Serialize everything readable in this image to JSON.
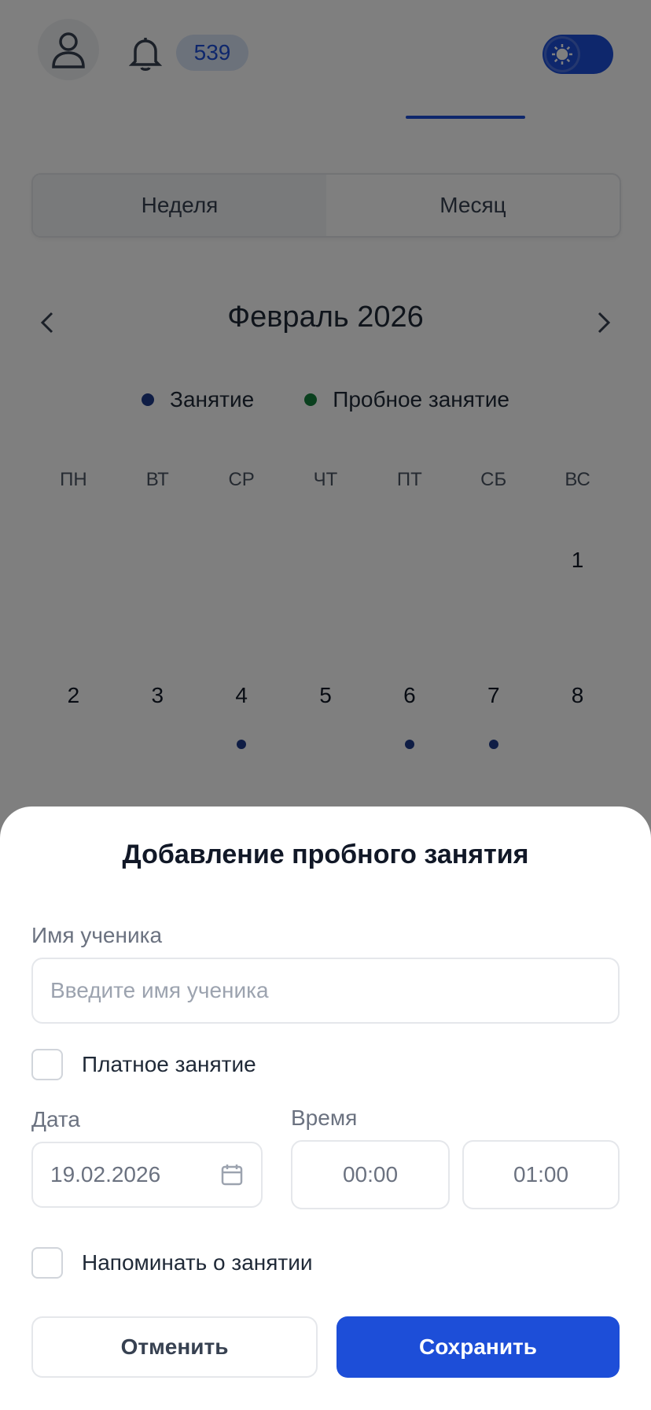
{
  "header": {
    "notifications_count": "539"
  },
  "view_switch": {
    "week_label": "Неделя",
    "month_label": "Месяц",
    "selected": "week"
  },
  "calendar": {
    "month_title": "Февраль 2026",
    "legend": [
      {
        "label": "Занятие",
        "color": "#1e3a8a"
      },
      {
        "label": "Пробное занятие",
        "color": "#15803d"
      }
    ],
    "weekdays": [
      "ПН",
      "ВТ",
      "СР",
      "ЧТ",
      "ПТ",
      "СБ",
      "ВС"
    ],
    "week1": [
      "",
      "",
      "",
      "",
      "",
      "",
      "1"
    ],
    "week2": [
      "2",
      "3",
      "4",
      "5",
      "6",
      "7",
      "8"
    ],
    "events_on_days": [
      "4",
      "6",
      "7"
    ]
  },
  "modal": {
    "title": "Добавление пробного занятия",
    "student_name_label": "Имя ученика",
    "student_name_placeholder": "Введите имя ученика",
    "student_name_value": "",
    "paid_label": "Платное занятие",
    "paid_checked": false,
    "date_label": "Дата",
    "date_value": "19.02.2026",
    "time_label": "Время",
    "time_start": "00:00",
    "time_end": "01:00",
    "remind_label": "Напоминать о занятии",
    "remind_checked": false,
    "cancel_label": "Отменить",
    "save_label": "Сохранить"
  },
  "colors": {
    "accent": "#1d4ed8",
    "event_dot": "#1e3a8a",
    "trial_dot": "#15803d",
    "overlay": "rgba(0,0,0,0.5)"
  }
}
